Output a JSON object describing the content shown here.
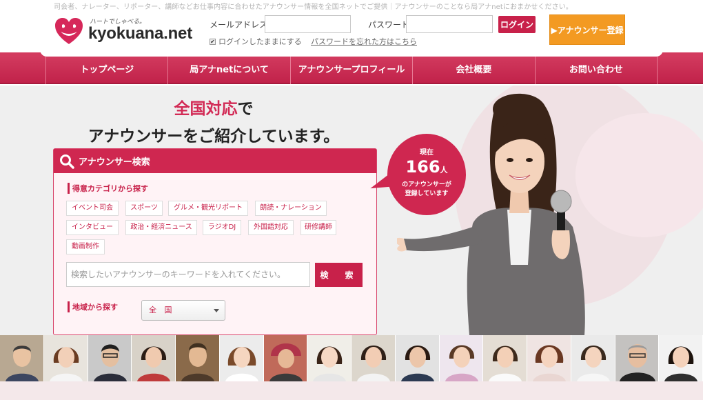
{
  "header": {
    "tagline": "司会者、ナレーター、リポーター、講師などお仕事内容に合わせたアナウンサー情報を全国ネットでご提供｜アナウンサーのことなら局アナnetにおまかせください。",
    "logo_sub": "ハートでしゃべる。",
    "logo_text": "kyokuana.net",
    "email_label": "メールアドレス",
    "password_label": "パスワード",
    "login_button": "ログイン",
    "remember_label": "ログインしたままにする",
    "forgot_link": "パスワードを忘れた方はこちら",
    "register_button": "▶アナウンサー登録"
  },
  "nav": {
    "items": [
      {
        "label": "トップページ"
      },
      {
        "label": "局アナnetについて"
      },
      {
        "label": "アナウンサープロフィール"
      },
      {
        "label": "会社概要"
      },
      {
        "label": "お問い合わせ"
      }
    ]
  },
  "hero": {
    "headline_accent": "全国対応",
    "headline_suffix": "で",
    "headline_line2": "アナウンサーをご紹介しています。"
  },
  "search": {
    "title": "アナウンサー検索",
    "category_label": "得意カテゴリから探す",
    "categories": [
      "イベント司会",
      "スポーツ",
      "グルメ・観光リポート",
      "朗読・ナレーション",
      "インタビュー",
      "政治・経済ニュース",
      "ラジオDJ",
      "外国語対応",
      "研修講師",
      "動画制作"
    ],
    "keyword_placeholder": "検索したいアナウンサーのキーワードを入れてください。",
    "search_button": "検　索",
    "region_label": "地域から探す",
    "region_selected": "全 国"
  },
  "bubble": {
    "line1": "現在",
    "count": "166",
    "unit": "人",
    "line3": "のアナウンサーが",
    "line4": "登録しています"
  },
  "colors": {
    "brand": "#cf2750",
    "orange": "#f39a22",
    "hero_bg": "#efefef"
  },
  "photo_strip_count": 16
}
